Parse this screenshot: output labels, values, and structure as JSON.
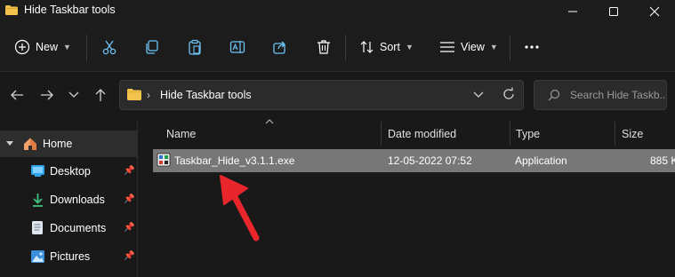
{
  "window": {
    "title": "Hide Taskbar tools",
    "minimize_icon": "minimize-icon",
    "maximize_icon": "maximize-icon",
    "close_icon": "close-icon"
  },
  "commandbar": {
    "new_label": "New",
    "sort_label": "Sort",
    "view_label": "View",
    "icons": [
      "new-icon",
      "cut-icon",
      "copy-icon",
      "paste-icon",
      "rename-icon",
      "share-icon",
      "delete-icon",
      "sort-icon",
      "view-icon",
      "more-icon"
    ]
  },
  "address": {
    "path": "Hide Taskbar tools",
    "search_placeholder": "Search Hide Taskb..."
  },
  "sidebar": {
    "items": [
      {
        "label": "Home",
        "icon": "home-icon",
        "expanded_icon": "chevron-down-icon",
        "pinned": false
      },
      {
        "label": "Desktop",
        "icon": "desktop-icon",
        "pinned": true
      },
      {
        "label": "Downloads",
        "icon": "download-icon",
        "pinned": true
      },
      {
        "label": "Documents",
        "icon": "documents-icon",
        "pinned": true
      },
      {
        "label": "Pictures",
        "icon": "pictures-icon",
        "pinned": true
      }
    ]
  },
  "table": {
    "columns": [
      "Name",
      "Date modified",
      "Type",
      "Size"
    ],
    "rows": [
      {
        "name": "Taskbar_Hide_v3.1.1.exe",
        "date": "12-05-2022 07:52",
        "type": "Application",
        "size": "885 K"
      }
    ]
  },
  "colors": {
    "background": "#191919",
    "selected_row": "#777777",
    "annotation_arrow": "#e8262c",
    "folder": "#f3c44d"
  }
}
